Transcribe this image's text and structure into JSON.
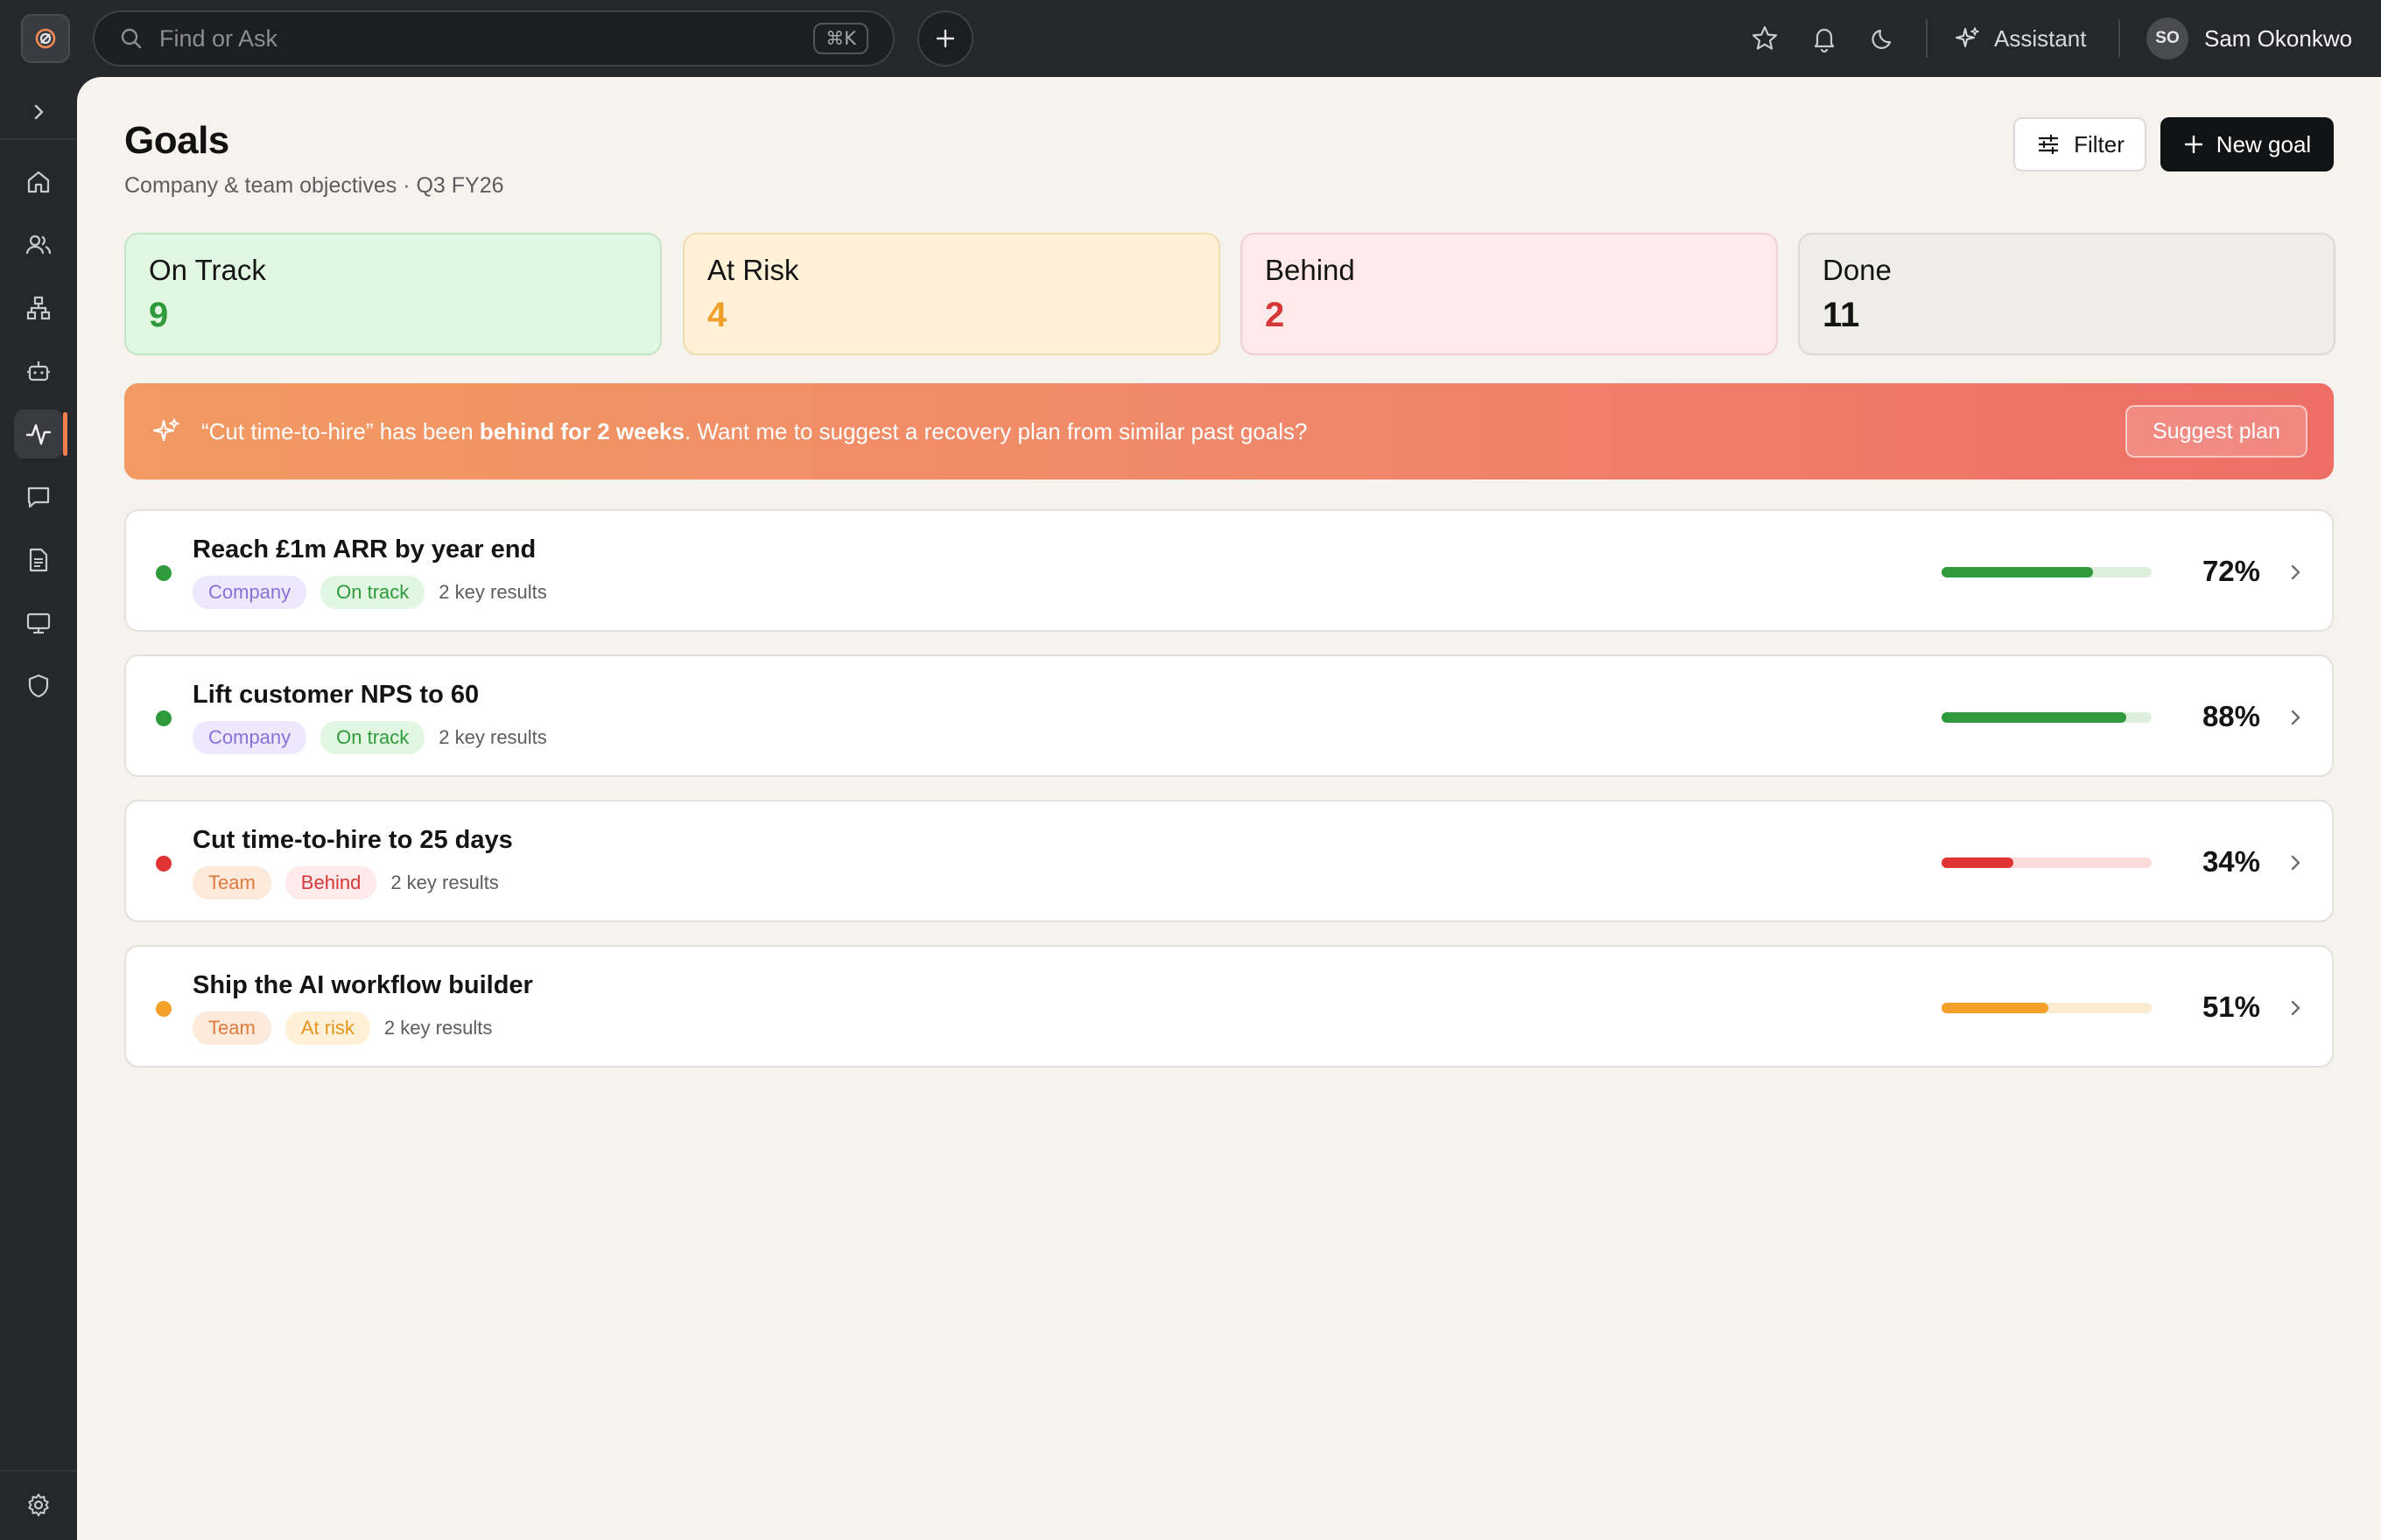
{
  "topbar": {
    "search_placeholder": "Find or Ask",
    "search_shortcut": "⌘K",
    "assistant_label": "Assistant",
    "user_initials": "SO",
    "user_name": "Sam Okonkwo"
  },
  "sidebar": {
    "items": [
      "home-icon",
      "people-icon",
      "org-chart-icon",
      "robot-icon",
      "activity-icon",
      "chat-icon",
      "document-icon",
      "monitor-icon",
      "shield-icon"
    ],
    "active_index": 4,
    "active_color": "#ef7d4d"
  },
  "header": {
    "title": "Goals",
    "subtitle": "Company & team objectives · Q3 FY26",
    "filter_label": "Filter",
    "new_label": "New goal"
  },
  "stats": [
    {
      "label": "On Track",
      "value": "9",
      "bg": "#e2f7e2",
      "border": "#c4e6c4",
      "color": "#2f9a3c"
    },
    {
      "label": "At Risk",
      "value": "4",
      "bg": "#fef1d8",
      "border": "#f0dcb0",
      "color": "#f0a02a"
    },
    {
      "label": "Behind",
      "value": "2",
      "bg": "#feeaea",
      "border": "#f3cfcf",
      "color": "#d63636"
    },
    {
      "label": "Done",
      "value": "11",
      "bg": "#eeede9",
      "border": "#dcdad5",
      "color": "#141414"
    }
  ],
  "banner": {
    "text_before": "“Cut time-to-hire” has been ",
    "text_bold": "behind for 2 weeks",
    "text_after": ". Want me to suggest a recovery plan from similar past goals?",
    "button_label": "Suggest plan"
  },
  "goals": [
    {
      "title": "Reach £1m ARR by year end",
      "scope": "Company",
      "status": "On track",
      "key_results": "2 key results",
      "progress": 72,
      "progress_label": "72%",
      "dot": "#2f9a3c",
      "fill": "#2f9a3c",
      "track": "#dcefdc",
      "scope_bg": "#ede8fb",
      "scope_fg": "#8a6fd8",
      "status_bg": "#e2f7e2",
      "status_fg": "#2f9a3c"
    },
    {
      "title": "Lift customer NPS to 60",
      "scope": "Company",
      "status": "On track",
      "key_results": "2 key results",
      "progress": 88,
      "progress_label": "88%",
      "dot": "#2f9a3c",
      "fill": "#2f9a3c",
      "track": "#dcefdc",
      "scope_bg": "#ede8fb",
      "scope_fg": "#8a6fd8",
      "status_bg": "#e2f7e2",
      "status_fg": "#2f9a3c"
    },
    {
      "title": "Cut time-to-hire to 25 days",
      "scope": "Team",
      "status": "Behind",
      "key_results": "2 key results",
      "progress": 34,
      "progress_label": "34%",
      "dot": "#e03333",
      "fill": "#e03333",
      "track": "#fadbd8",
      "scope_bg": "#fdeadb",
      "scope_fg": "#e07a3e",
      "status_bg": "#feeaea",
      "status_fg": "#d63636"
    },
    {
      "title": "Ship the AI workflow builder",
      "scope": "Team",
      "status": "At risk",
      "key_results": "2 key results",
      "progress": 51,
      "progress_label": "51%",
      "dot": "#f4a02a",
      "fill": "#f4a02a",
      "track": "#fbebd2",
      "scope_bg": "#fdeadb",
      "scope_fg": "#e07a3e",
      "status_bg": "#fef1d8",
      "status_fg": "#e3941d"
    }
  ]
}
